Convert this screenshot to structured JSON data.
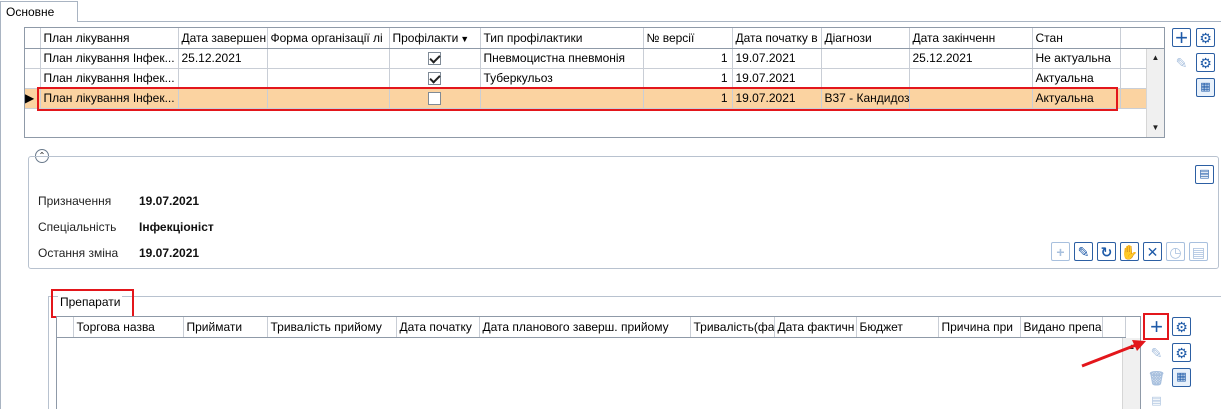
{
  "tabs": [
    {
      "label": "Основне"
    }
  ],
  "plans_grid": {
    "columns": [
      "План лікування",
      "Дата завершен",
      "Форма організації лі",
      "Профілакти",
      "Тип профілактики",
      "№ версії",
      "Дата початку в",
      "Діагнози",
      "Дата закінченн",
      "Стан"
    ],
    "rows": [
      {
        "plan": "План лікування Інфек...",
        "end_date": "25.12.2021",
        "form": "",
        "prophylaxis": true,
        "type": "Пневмоцистна пневмонія",
        "version": "1",
        "start": "19.07.2021",
        "diagnoses": "",
        "finish": "25.12.2021",
        "state": "Не актуальна"
      },
      {
        "plan": "План лікування Інфек...",
        "end_date": "",
        "form": "",
        "prophylaxis": true,
        "type": "Туберкульоз",
        "version": "1",
        "start": "19.07.2021",
        "diagnoses": "",
        "finish": "",
        "state": "Актуальна"
      },
      {
        "plan": "План лікування Інфек...",
        "end_date": "",
        "form": "",
        "prophylaxis": false,
        "type": "",
        "version": "1",
        "start": "19.07.2021",
        "diagnoses": "B37 - Кандидоз",
        "finish": "",
        "state": "Актуальна"
      }
    ],
    "selected_row": 3
  },
  "details": {
    "fields": [
      {
        "label": "Призначення",
        "value": "19.07.2021"
      },
      {
        "label": "Спеціальність",
        "value": "Інфекціоніст"
      },
      {
        "label": "Остання зміна",
        "value": "19.07.2021"
      }
    ]
  },
  "drugs": {
    "title": "Препарати",
    "columns": [
      "Торгова назва",
      "Приймати",
      "Тривалість прийому",
      "Дата початку",
      "Дата планового заверш. прийому",
      "Тривалість(фа",
      "Дата фактичн",
      "Бюджет",
      "Причина при",
      "Видано препа"
    ]
  },
  "icons": {
    "add": "plus-icon",
    "settings": "gear-icon",
    "edit": "edit-icon",
    "export": "excel-icon",
    "delete": "trash-icon"
  },
  "colors": {
    "accent": "#1e5aa8",
    "selection": "#fbd3a1",
    "highlight": "#e3161b"
  }
}
